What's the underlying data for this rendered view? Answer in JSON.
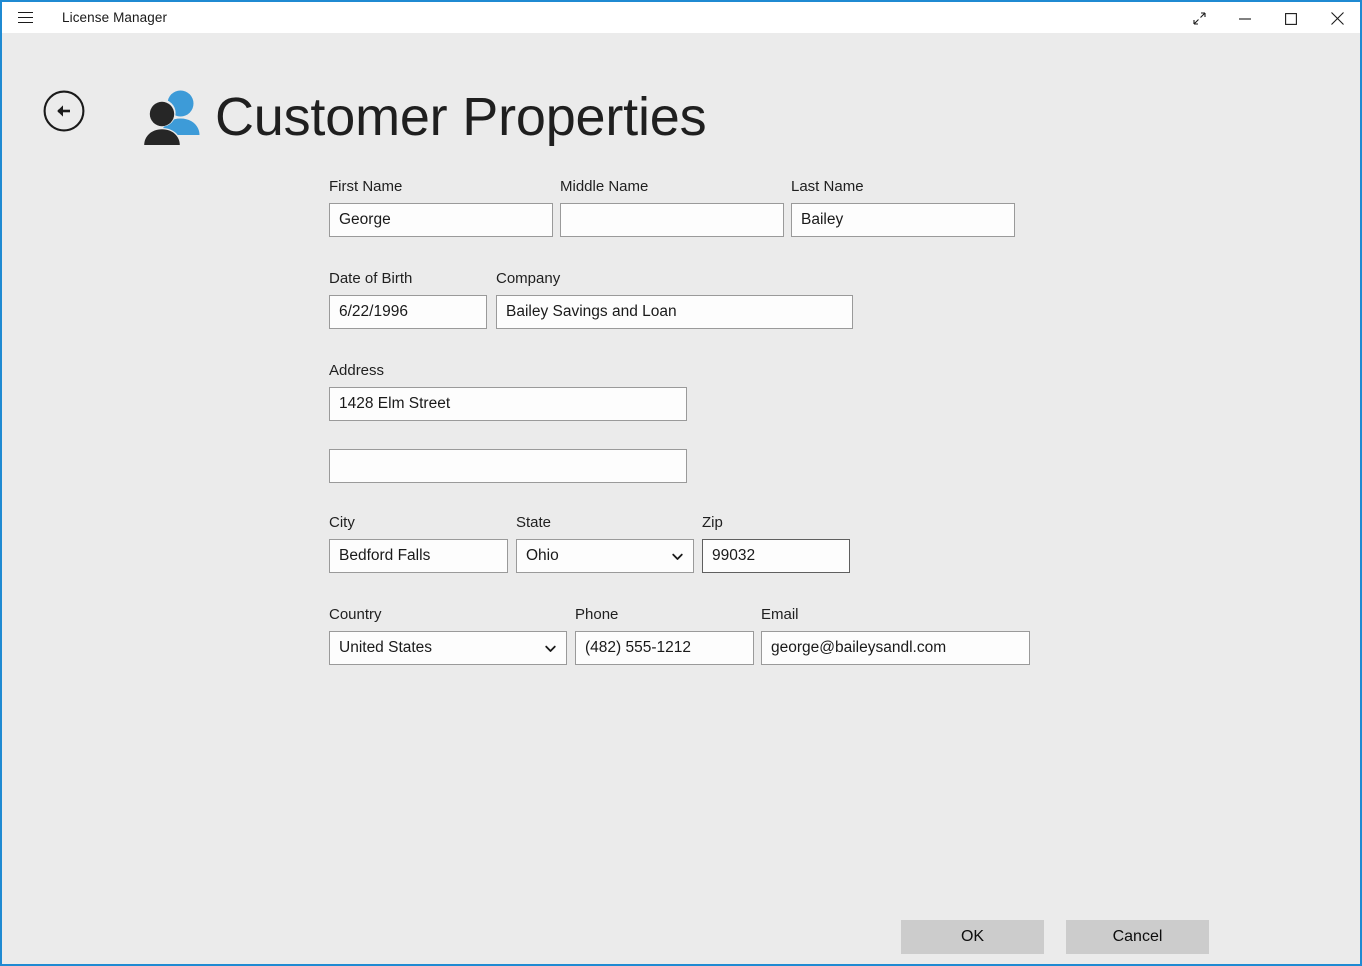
{
  "window": {
    "accent_color": "#1f8ad2",
    "background_color": "#ebebeb",
    "titlebar_color": "#ffffff",
    "app_title": "License Manager",
    "menu_icon": "hamburger-icon",
    "controls": [
      {
        "name": "restore-down",
        "icon": "diagonal-arrows-icon"
      },
      {
        "name": "minimize",
        "icon": "minimize-icon"
      },
      {
        "name": "maximize",
        "icon": "maximize-icon"
      },
      {
        "name": "close",
        "icon": "close-icon"
      }
    ]
  },
  "header": {
    "back_icon": "back-arrow-circle-icon",
    "people_icon": "two-people-icon",
    "people_icon_dark_color": "#262626",
    "people_icon_blue_color": "#3d9bd8",
    "title": "Customer Properties"
  },
  "form": {
    "first_name": {
      "label": "First Name",
      "value": "George"
    },
    "middle_name": {
      "label": "Middle Name",
      "value": ""
    },
    "last_name": {
      "label": "Last Name",
      "value": "Bailey"
    },
    "date_of_birth": {
      "label": "Date of Birth",
      "value": "6/22/1996"
    },
    "company": {
      "label": "Company",
      "value": "Bailey Savings and Loan"
    },
    "address": {
      "label": "Address",
      "value": "1428 Elm Street"
    },
    "address2": {
      "label": "",
      "value": ""
    },
    "city": {
      "label": "City",
      "value": "Bedford Falls"
    },
    "state": {
      "label": "State",
      "value": "Ohio"
    },
    "zip": {
      "label": "Zip",
      "value": "99032"
    },
    "country": {
      "label": "Country",
      "value": "United States"
    },
    "phone": {
      "label": "Phone",
      "value": "(482) 555-1212"
    },
    "email": {
      "label": "Email",
      "value": "george@baileysandl.com"
    }
  },
  "footer": {
    "ok_label": "OK",
    "cancel_label": "Cancel"
  }
}
